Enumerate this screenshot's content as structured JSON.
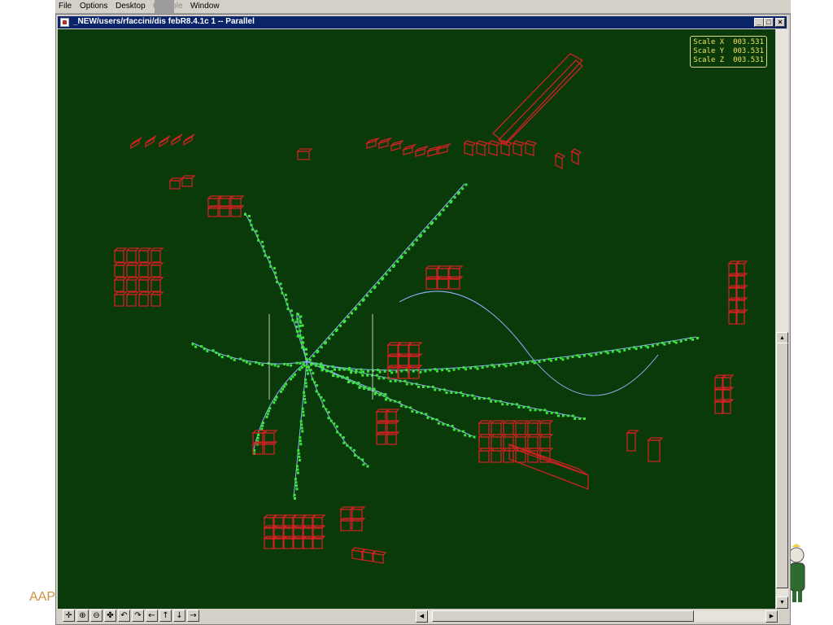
{
  "menubar": {
    "items": [
      {
        "label": "File",
        "enabled": true
      },
      {
        "label": "Options",
        "enabled": true
      },
      {
        "label": "Desktop",
        "enabled": true
      },
      {
        "label": "Console",
        "enabled": false
      },
      {
        "label": "Window",
        "enabled": true
      }
    ]
  },
  "window": {
    "title": "_NEW/users/rfaccini/dis    febR8.4.1c 1 -- Parallel",
    "buttons": [
      "_",
      "□",
      "×"
    ]
  },
  "scale_readout": {
    "x": "Scale X  003.531",
    "y": "Scale Y  003.531",
    "z": "Scale Z  003.531"
  },
  "toolbar": {
    "tools": [
      {
        "name": "move-tool",
        "glyph": "✛"
      },
      {
        "name": "zoom-in-tool",
        "glyph": "⊕"
      },
      {
        "name": "zoom-out-tool",
        "glyph": "⊖"
      },
      {
        "name": "pan-tool",
        "glyph": "✤"
      },
      {
        "name": "rotate-left-tool",
        "glyph": "↶"
      },
      {
        "name": "rotate-right-tool",
        "glyph": "↷"
      },
      {
        "name": "arrow-left-tool",
        "glyph": "←"
      },
      {
        "name": "arrow-up-tool",
        "glyph": "↑"
      },
      {
        "name": "arrow-down-tool",
        "glyph": "↓"
      },
      {
        "name": "arrow-right-tool",
        "glyph": "→"
      }
    ]
  },
  "background_text": {
    "slide_label": "AAP"
  },
  "colors": {
    "canvas_bg": "#0a3a0a",
    "hits": "#39e639",
    "detector": "#cc2222",
    "track": "#8fb4ff",
    "titlebar": "#0a246a"
  }
}
